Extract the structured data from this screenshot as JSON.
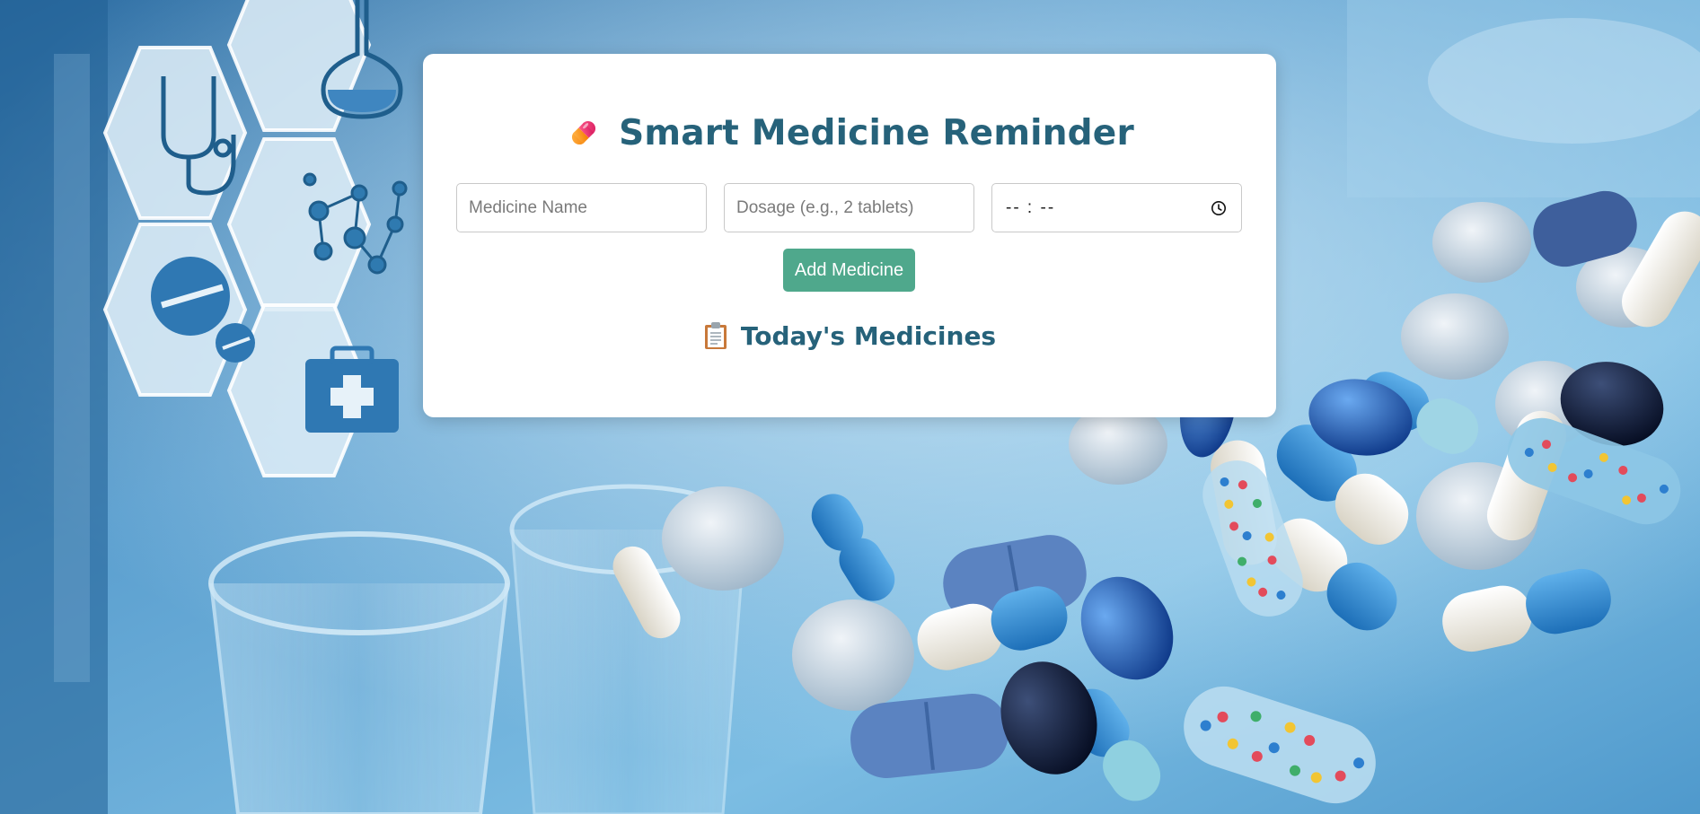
{
  "app": {
    "title": "Smart Medicine Reminder",
    "title_icon": "pill-icon"
  },
  "form": {
    "medicine_name_placeholder": "Medicine Name",
    "medicine_name_value": "",
    "dosage_placeholder": "Dosage (e.g., 2 tablets)",
    "dosage_value": "",
    "time_display": "-- : --",
    "time_icon": "clock-icon",
    "add_button_label": "Add Medicine"
  },
  "list": {
    "heading": "Today's Medicines",
    "heading_icon": "clipboard-icon",
    "items": []
  },
  "colors": {
    "heading": "#26627a",
    "button": "#4fa88c",
    "card": "#ffffff"
  },
  "background": {
    "description_icons": [
      "stethoscope-icon",
      "flask-icon",
      "molecule-icon",
      "pill-tablet-icon",
      "medical-kit-icon"
    ]
  }
}
